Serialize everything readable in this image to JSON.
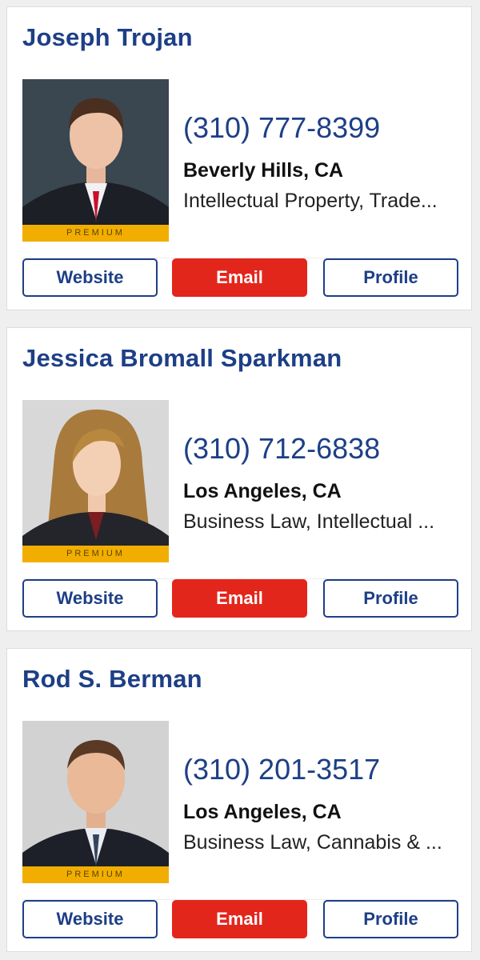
{
  "attorneys": [
    {
      "name": "Joseph Trojan",
      "phone": "(310) 777-8399",
      "location": "Beverly Hills, CA",
      "practice": "Intellectual Property, Trade...",
      "badge": "PREMIUM",
      "buttons": {
        "website": "Website",
        "email": "Email",
        "profile": "Profile"
      }
    },
    {
      "name": "Jessica Bromall Sparkman",
      "phone": "(310) 712-6838",
      "location": "Los Angeles, CA",
      "practice": "Business Law, Intellectual ...",
      "badge": "PREMIUM",
      "buttons": {
        "website": "Website",
        "email": "Email",
        "profile": "Profile"
      }
    },
    {
      "name": "Rod S. Berman",
      "phone": "(310) 201-3517",
      "location": "Los Angeles, CA",
      "practice": "Business Law, Cannabis & ...",
      "badge": "PREMIUM",
      "buttons": {
        "website": "Website",
        "email": "Email",
        "profile": "Profile"
      }
    }
  ],
  "colors": {
    "brand_blue": "#1d3f86",
    "email_red": "#e3261c",
    "premium_gold": "#f2ae00"
  }
}
